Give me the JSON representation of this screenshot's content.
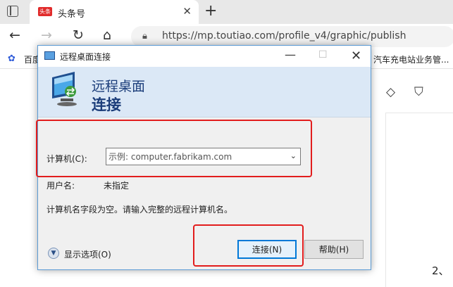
{
  "browser": {
    "tab_title": "头条号",
    "favicon_text": "头条",
    "url": "https://mp.toutiao.com/profile_v4/graphic/publish",
    "icons": [
      "page-icon",
      "close-icon",
      "plus-icon",
      "back-icon",
      "forward-icon",
      "reload-icon",
      "home-icon",
      "lock-icon",
      "paw-icon"
    ],
    "bookmarks": {
      "baidu": "百度",
      "right": "汽车充电站业务管..."
    }
  },
  "page": {
    "side_text": "2、"
  },
  "dialog": {
    "title": "远程桌面连接",
    "banner_line1": "远程桌面",
    "banner_line2": "连接",
    "computer_label": "计算机(C):",
    "computer_placeholder": "示例: computer.fabrikam.com",
    "user_label": "用户名:",
    "user_value": "未指定",
    "info": "计算机名字段为空。请输入完整的远程计算机名。",
    "options": "显示选项(O)",
    "connect": "连接(N)",
    "help": "帮助(H)"
  },
  "colors": {
    "highlight": "#e21d1d",
    "accent": "#0078d7",
    "banner_text": "#1b3d7a"
  }
}
